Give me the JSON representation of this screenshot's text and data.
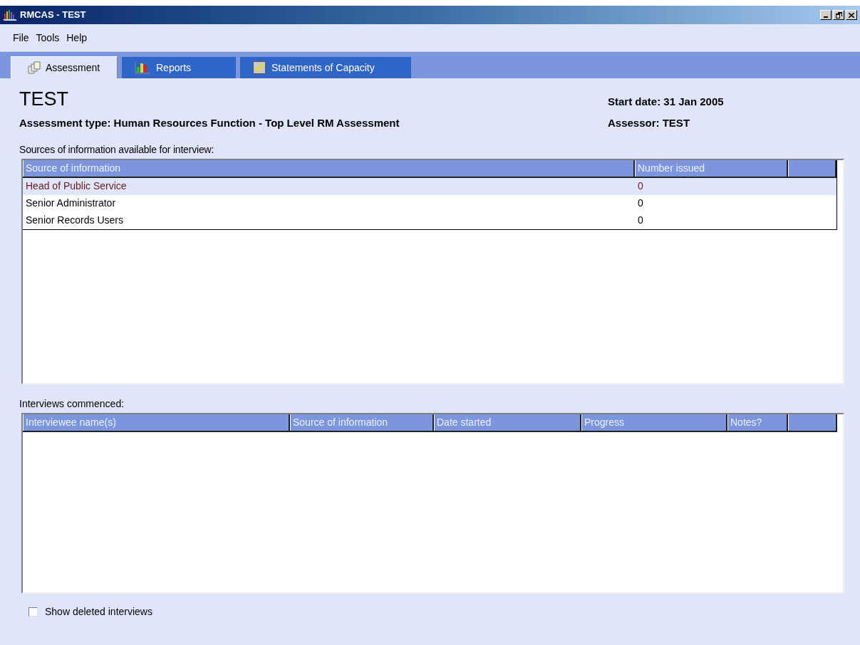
{
  "window": {
    "title": "RMCAS - TEST"
  },
  "menu": [
    "File",
    "Tools",
    "Help"
  ],
  "tabs": [
    {
      "label": "Assessment",
      "selected": true,
      "kind": "boxes"
    },
    {
      "label": "Reports",
      "selected": false,
      "kind": "chart"
    },
    {
      "label": "Statements of Capacity",
      "selected": false,
      "kind": "check"
    }
  ],
  "heading": "TEST",
  "start_date": "Start date: 31 Jan 2005",
  "assessment_type": "Assessment type: Human Resources Function - Top Level RM Assessment",
  "assessor": "Assessor: TEST",
  "sources": {
    "label": "Sources of information available for interview:",
    "columns": [
      "Source of information",
      "Number issued"
    ],
    "rows": [
      {
        "cells": [
          "Head of Public Service",
          "0"
        ],
        "selected": true
      },
      {
        "cells": [
          "Senior Administrator",
          "0"
        ],
        "selected": false
      },
      {
        "cells": [
          "Senior Records Users",
          "0"
        ],
        "selected": false
      }
    ]
  },
  "interviews": {
    "label": "Interviews commenced:",
    "columns": [
      "Interviewee name(s)",
      "Source of information",
      "Date started",
      "Progress",
      "Notes?"
    ]
  },
  "show_deleted": {
    "label": "Show deleted interviews",
    "checked": false
  }
}
